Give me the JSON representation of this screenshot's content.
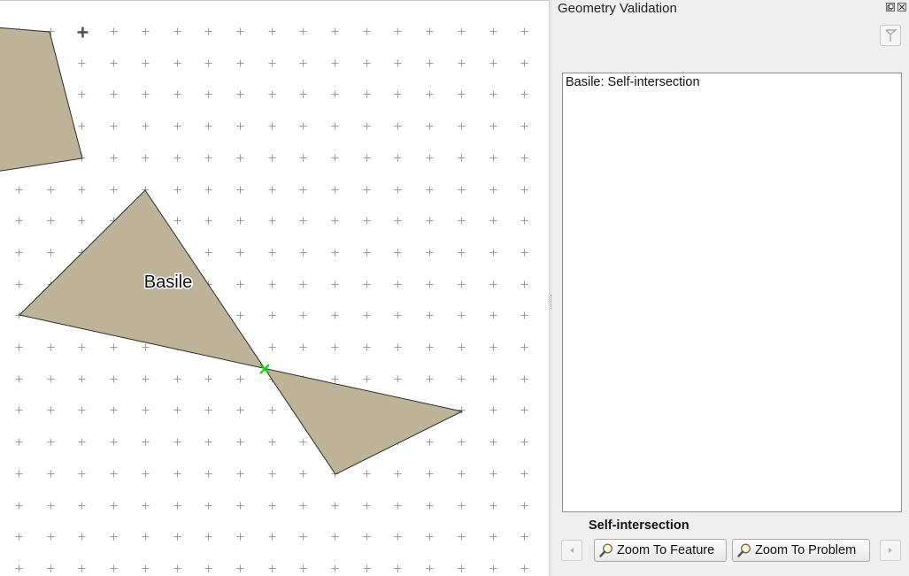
{
  "map": {
    "feature_label": "Basile",
    "polygon_fill": "#bdb399",
    "polygon_stroke": "#2b2b2b",
    "grid_color": "#9a9a9a",
    "marker_color": "#00dd00"
  },
  "dock": {
    "title": "Geometry Validation",
    "errors": [
      {
        "label": "Basile: Self-intersection"
      }
    ],
    "current_error_type": "Self-intersection",
    "buttons": {
      "zoom_to_feature": "Zoom To Feature",
      "zoom_to_problem": "Zoom To Problem"
    }
  },
  "icons": {
    "toolbar": "select-feature-icon",
    "zoom": "magnifier-icon",
    "prev": "chevron-left-icon",
    "next": "chevron-right-icon"
  }
}
